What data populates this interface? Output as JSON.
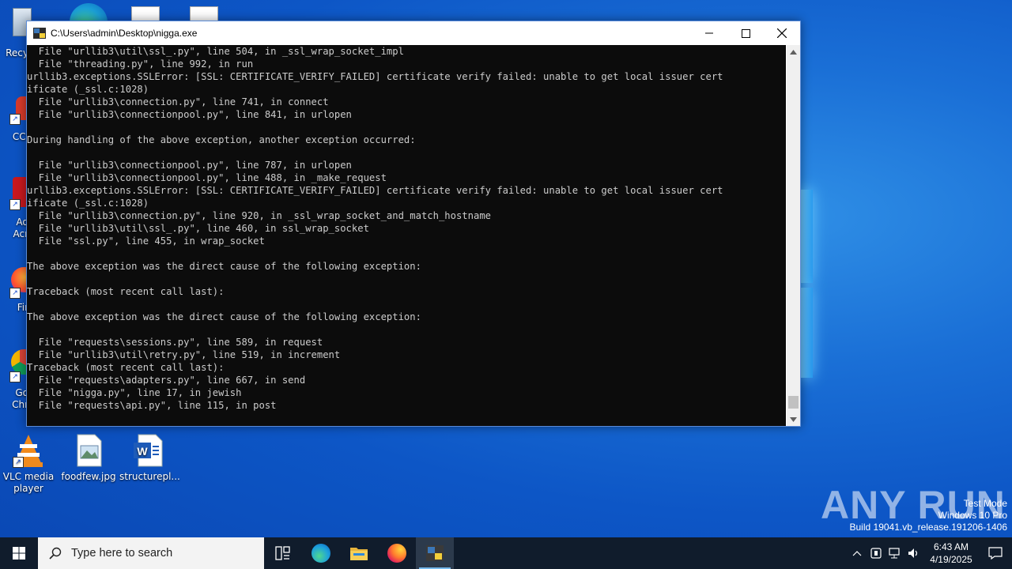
{
  "window": {
    "title": "C:\\Users\\admin\\Desktop\\nigga.exe",
    "console_lines": [
      "  File \"urllib3\\util\\ssl_.py\", line 504, in _ssl_wrap_socket_impl",
      "  File \"threading.py\", line 992, in run",
      "urllib3.exceptions.SSLError: [SSL: CERTIFICATE_VERIFY_FAILED] certificate verify failed: unable to get local issuer cert",
      "ificate (_ssl.c:1028)",
      "  File \"urllib3\\connection.py\", line 741, in connect",
      "  File \"urllib3\\connectionpool.py\", line 841, in urlopen",
      "",
      "During handling of the above exception, another exception occurred:",
      "",
      "  File \"urllib3\\connectionpool.py\", line 787, in urlopen",
      "  File \"urllib3\\connectionpool.py\", line 488, in _make_request",
      "urllib3.exceptions.SSLError: [SSL: CERTIFICATE_VERIFY_FAILED] certificate verify failed: unable to get local issuer cert",
      "ificate (_ssl.c:1028)",
      "  File \"urllib3\\connection.py\", line 920, in _ssl_wrap_socket_and_match_hostname",
      "  File \"urllib3\\util\\ssl_.py\", line 460, in ssl_wrap_socket",
      "  File \"ssl.py\", line 455, in wrap_socket",
      "",
      "The above exception was the direct cause of the following exception:",
      "",
      "Traceback (most recent call last):",
      "",
      "The above exception was the direct cause of the following exception:",
      "",
      "  File \"requests\\sessions.py\", line 589, in request",
      "  File \"urllib3\\util\\retry.py\", line 519, in increment",
      "Traceback (most recent call last):",
      "  File \"requests\\adapters.py\", line 667, in send",
      "  File \"nigga.py\", line 17, in jewish",
      "  File \"requests\\api.py\", line 115, in post"
    ]
  },
  "desktop": {
    "left_partial_labels": [
      "Recy",
      "CCl",
      "Ad",
      "Acr",
      "Fir",
      "Go",
      "Chr"
    ],
    "icons": [
      {
        "label": "VLC media player",
        "icon": "vlc-icon"
      },
      {
        "label": "foodfew.jpg",
        "icon": "image-file-icon"
      },
      {
        "label": "structurepl...",
        "icon": "word-document-icon"
      }
    ]
  },
  "watermark": {
    "brand": "ANY RUN",
    "line1": "Test Mode",
    "line2": "Windows 10 Pro",
    "line3": "Build 19041.vb_release.191206-1406"
  },
  "taskbar": {
    "search_placeholder": "Type here to search",
    "apps": [
      "task-view-icon",
      "edge-icon",
      "file-explorer-icon",
      "firefox-icon",
      "python-console-icon"
    ],
    "time": "6:43 AM",
    "date": "4/19/2025"
  },
  "colors": {
    "desktop": "#0d56c6",
    "console_bg": "#0c0c0c",
    "console_text": "#cccccc",
    "taskbar": "#101c2c"
  }
}
